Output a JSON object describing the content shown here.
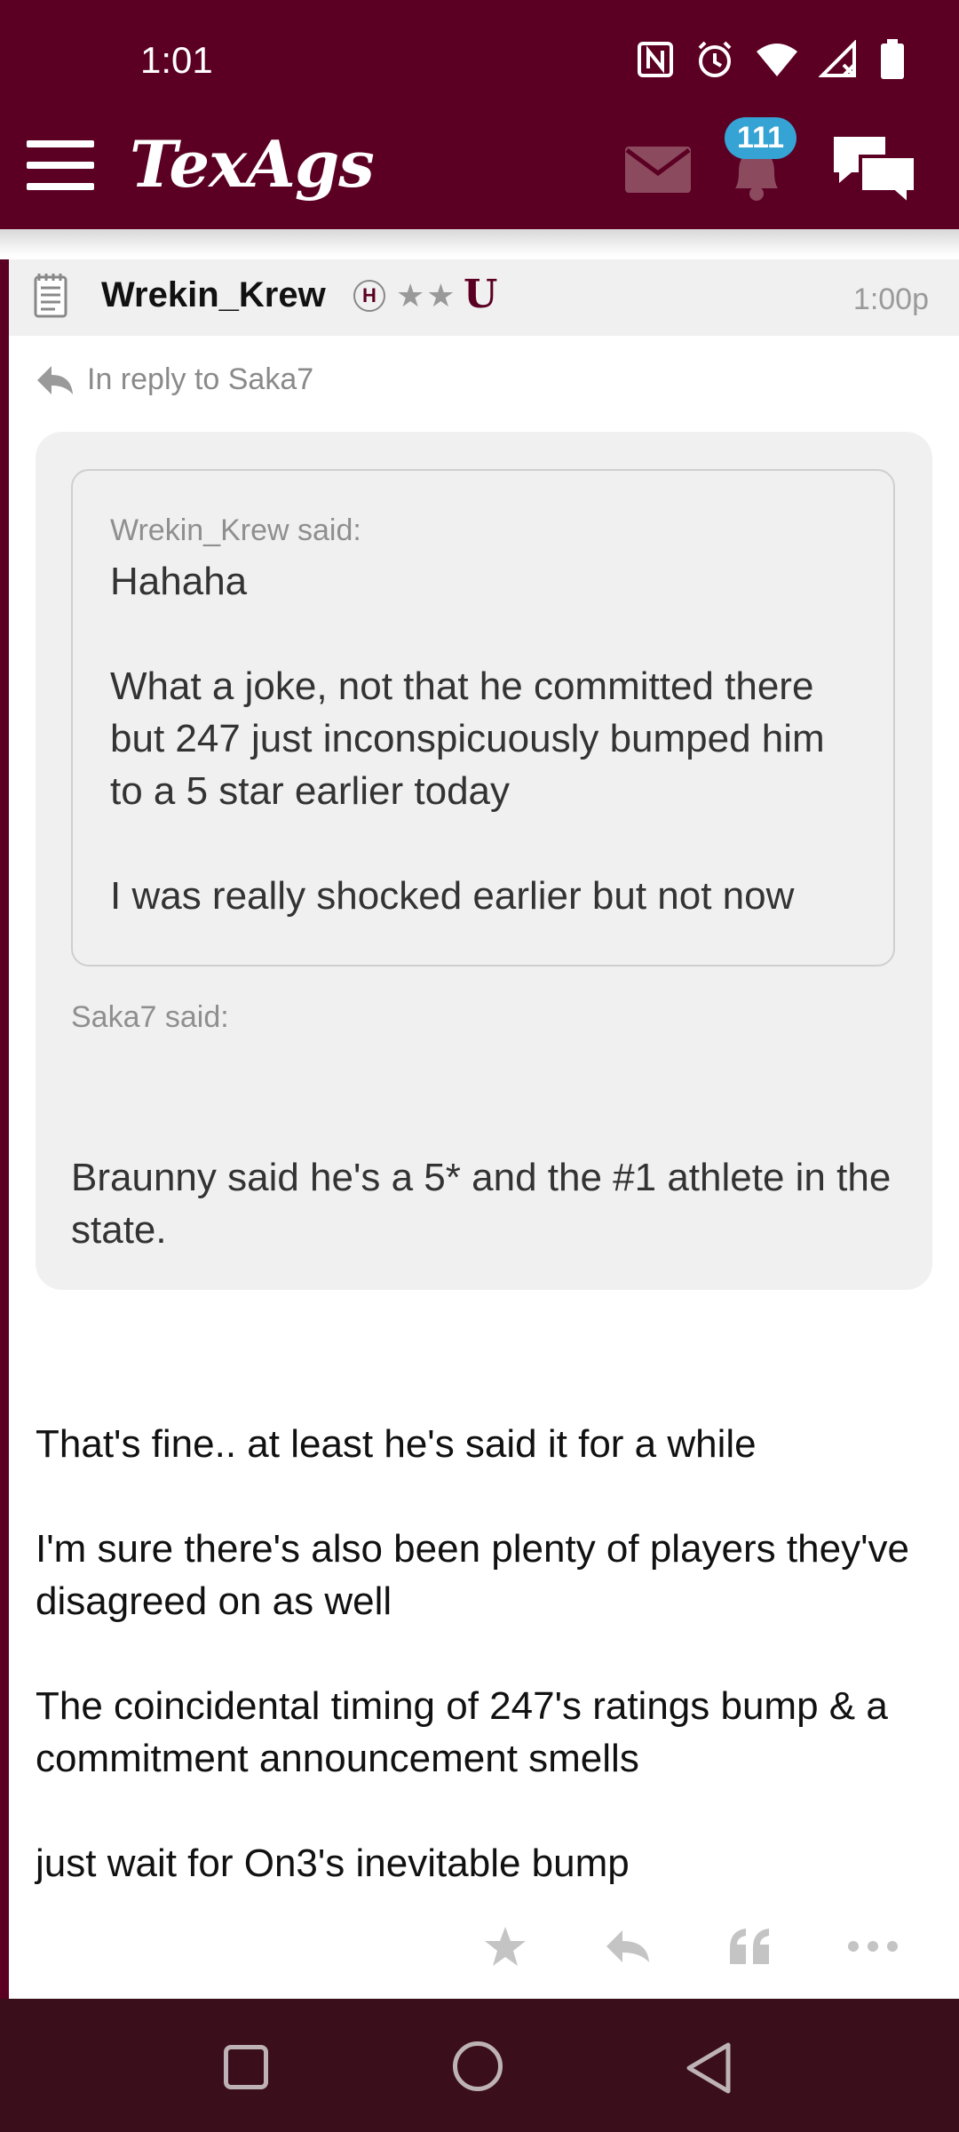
{
  "status": {
    "time": "1:01"
  },
  "header": {
    "logo": "TexAgs",
    "notification_count": "111"
  },
  "post": {
    "author": "Wrekin_Krew",
    "badge_letter": "H",
    "stars": "★★",
    "team_logo": "U",
    "time": "1:00p",
    "reply_to": "In reply to Saka7",
    "inner_quote": {
      "said": "Wrekin_Krew said:",
      "paragraphs": [
        "Hahaha",
        "What a joke, not that he committed there but 247 just inconspicuously bumped him to a 5 star earlier today",
        "I was really shocked earlier but not now"
      ]
    },
    "outer_quote": {
      "said": "Saka7 said:",
      "text": "Braunny said he's a 5* and the #1 athlete in the state."
    },
    "body": [
      "That's fine.. at least he's said it for a while",
      "I'm sure there's also been plenty of players they've disagreed on as well",
      "The coincidental timing of 247's ratings bump & a commitment announcement smells",
      "just wait for On3's inevitable bump"
    ]
  },
  "colors": {
    "brand": "#5c0023",
    "badge": "#35a3d4",
    "navbar": "#3a0e1b"
  }
}
